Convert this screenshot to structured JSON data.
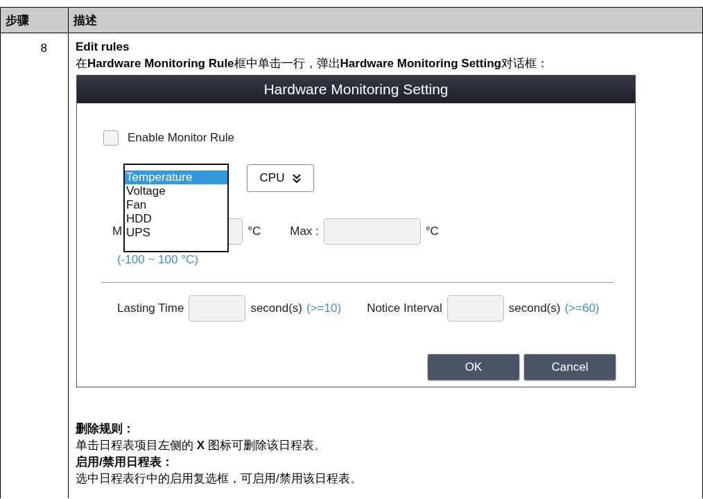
{
  "table": {
    "columns": [
      "步骤",
      "描述"
    ],
    "rows": [
      {
        "step": "8",
        "title": "Edit rules",
        "intro": "在**Hardware Monitoring Rule**框中单击一行，弹出**Hardware Monitoring Setting**对话框：",
        "dialog": {
          "title": "Hardware Monitoring Setting",
          "enable_rule": {
            "label": "Enable Monitor Rule",
            "checked": false
          },
          "type_list": {
            "options": [
              {
                "label": "Temperature",
                "selected": true
              },
              {
                "label": "Voltage",
                "selected": false
              },
              {
                "label": "Fan",
                "selected": false
              },
              {
                "label": "HDD",
                "selected": false
              },
              {
                "label": "UPS",
                "selected": false
              }
            ]
          },
          "component_select": {
            "value": "CPU"
          },
          "min": {
            "label": "M",
            "unit": "°C"
          },
          "max": {
            "label": "Max :",
            "unit": "°C"
          },
          "range_hint": "(-100 ~ 100 °C)",
          "lasting_time": {
            "label": "Lasting Time",
            "unit": "second(s)",
            "hint": "(>=10)"
          },
          "notice_interval": {
            "label": "Notice Interval",
            "unit": "second(s)",
            "hint": "(>=60)"
          },
          "buttons": [
            "OK",
            "Cancel"
          ]
        },
        "notes": [
          {
            "heading": "删除规则：",
            "text": "单击日程表项目左侧的 **X** 图标可删除该日程表。"
          },
          {
            "heading": "启用/禁用日程表：",
            "text": "选中日程表行中的启用复选框，可启用/禁用该日程表。"
          }
        ]
      }
    ]
  }
}
